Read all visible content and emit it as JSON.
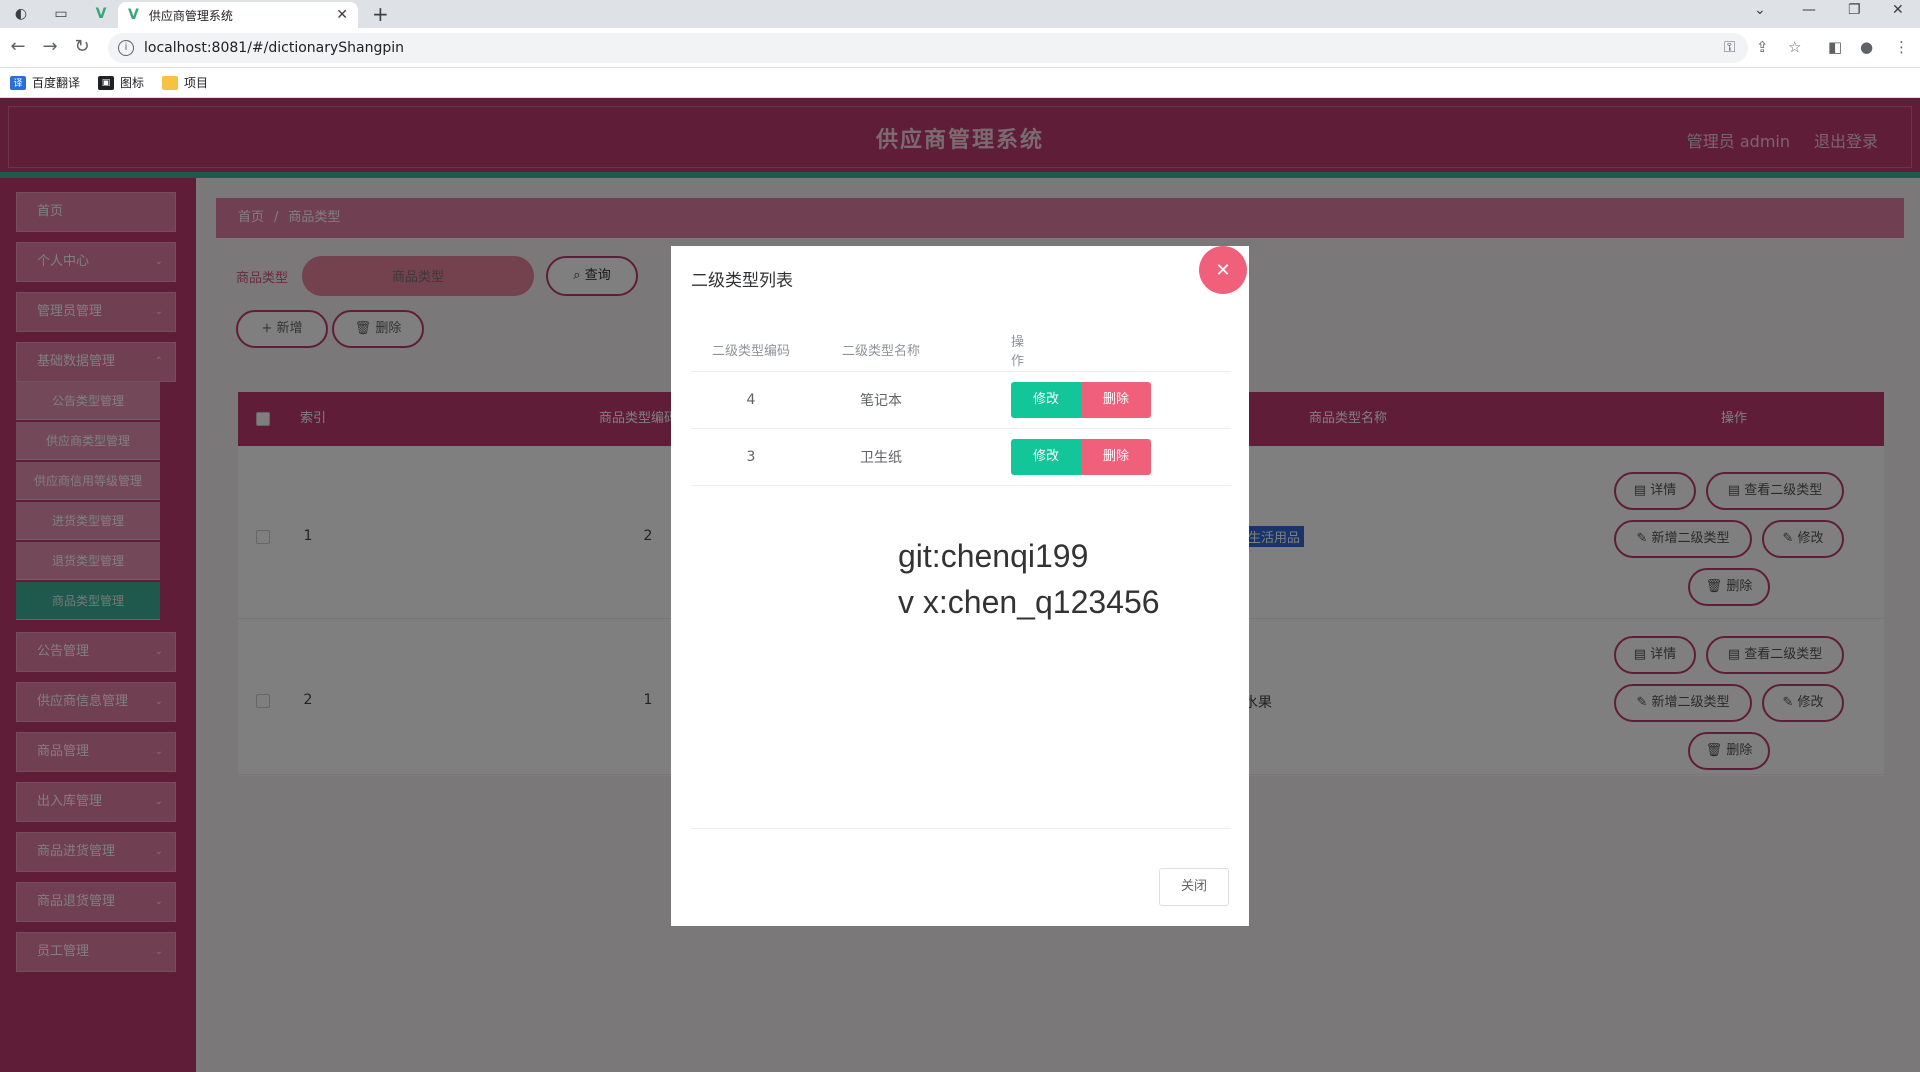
{
  "browser": {
    "tab_title": "供应商管理系统",
    "url": "localhost:8081/#/dictionaryShangpin",
    "bookmarks": [
      {
        "label": "百度翻译",
        "color": "#2b6fd6"
      },
      {
        "label": "图标",
        "color": "#202124"
      },
      {
        "label": "项目",
        "color": "#f5c242"
      }
    ]
  },
  "header": {
    "title": "供应商管理系统",
    "user": "管理员 admin",
    "logout": "退出登录"
  },
  "sidebar": {
    "items": [
      {
        "label": "首页"
      },
      {
        "label": "个人中心"
      },
      {
        "label": "管理员管理"
      },
      {
        "label": "基础数据管理"
      },
      {
        "label": "公告管理"
      },
      {
        "label": "供应商信息管理"
      },
      {
        "label": "商品管理"
      },
      {
        "label": "出入库管理"
      },
      {
        "label": "商品进货管理"
      },
      {
        "label": "商品退货管理"
      },
      {
        "label": "员工管理"
      }
    ],
    "subitems": [
      {
        "label": "公告类型管理"
      },
      {
        "label": "供应商类型管理"
      },
      {
        "label": "供应商信用等级管理"
      },
      {
        "label": "进货类型管理"
      },
      {
        "label": "退货类型管理"
      },
      {
        "label": "商品类型管理"
      }
    ]
  },
  "breadcrumb": {
    "home": "首页",
    "current": "商品类型"
  },
  "search": {
    "label": "商品类型",
    "placeholder": "商品类型",
    "query_button": "查询"
  },
  "actions": {
    "add": "新增",
    "delete": "删除"
  },
  "table": {
    "headers": {
      "index": "索引",
      "code": "商品类型编码",
      "name": "商品类型名称",
      "ops": "操作"
    },
    "rows": [
      {
        "index": "1",
        "code": "2",
        "name": "生活用品"
      },
      {
        "index": "2",
        "code": "1",
        "name": "水果"
      }
    ],
    "op_labels": {
      "detail": "详情",
      "view_sub": "查看二级类型",
      "add_sub": "新增二级类型",
      "edit": "修改",
      "delete": "删除"
    }
  },
  "modal": {
    "title": "二级类型列表",
    "headers": {
      "code": "二级类型编码",
      "name": "二级类型名称",
      "ops": "操作"
    },
    "rows": [
      {
        "code": "4",
        "name": "笔记本",
        "edit": "修改",
        "delete": "删除"
      },
      {
        "code": "3",
        "name": "卫生纸",
        "edit": "修改",
        "delete": "删除"
      }
    ],
    "watermark_line1": "git:chenqi199",
    "watermark_line2": "v x:chen_q123456",
    "close_button": "关闭"
  },
  "colors": {
    "primary": "#c13a6e",
    "accent": "#3eb39a",
    "edit": "#13c69a",
    "danger": "#f0607b"
  }
}
